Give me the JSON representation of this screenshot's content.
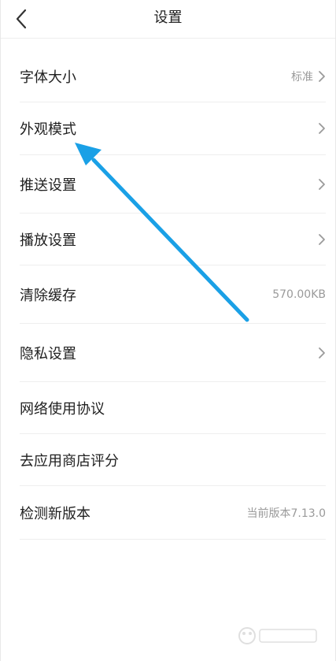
{
  "header": {
    "title": "设置"
  },
  "items": [
    {
      "label": "字体大小",
      "value": "标准",
      "has_chevron": true
    },
    {
      "label": "外观模式",
      "value": "",
      "has_chevron": true
    },
    {
      "label": "推送设置",
      "value": "",
      "has_chevron": true
    },
    {
      "label": "播放设置",
      "value": "",
      "has_chevron": true
    },
    {
      "label": "清除缓存",
      "value": "570.00KB",
      "has_chevron": false
    },
    {
      "label": "隐私设置",
      "value": "",
      "has_chevron": true
    },
    {
      "label": "网络使用协议",
      "value": "",
      "has_chevron": false
    },
    {
      "label": "去应用商店评分",
      "value": "",
      "has_chevron": false
    },
    {
      "label": "检测新版本",
      "value": "当前版本7.13.0",
      "has_chevron": false
    }
  ],
  "colors": {
    "annotation_arrow": "#1aa0e6",
    "divider": "#eeeeee",
    "secondary_text": "#9a9a9a"
  }
}
